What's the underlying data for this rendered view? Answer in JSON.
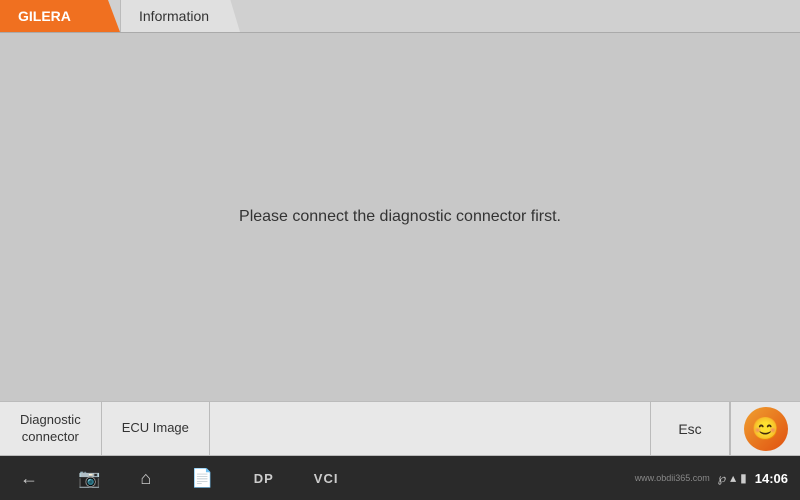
{
  "header": {
    "brand_label": "GILERA",
    "tab_label": "Information"
  },
  "main": {
    "message": "Please connect the diagnostic connector first."
  },
  "bottom_bar": {
    "btn1_label": "Diagnostic\nconnector",
    "btn2_label": "ECU Image",
    "esc_label": "Esc"
  },
  "footer": {
    "dp_label": "DP",
    "vci_label": "VCI",
    "time": "14:06",
    "brand_url": "www.obdii365.com",
    "logo_emoji": "😊"
  }
}
